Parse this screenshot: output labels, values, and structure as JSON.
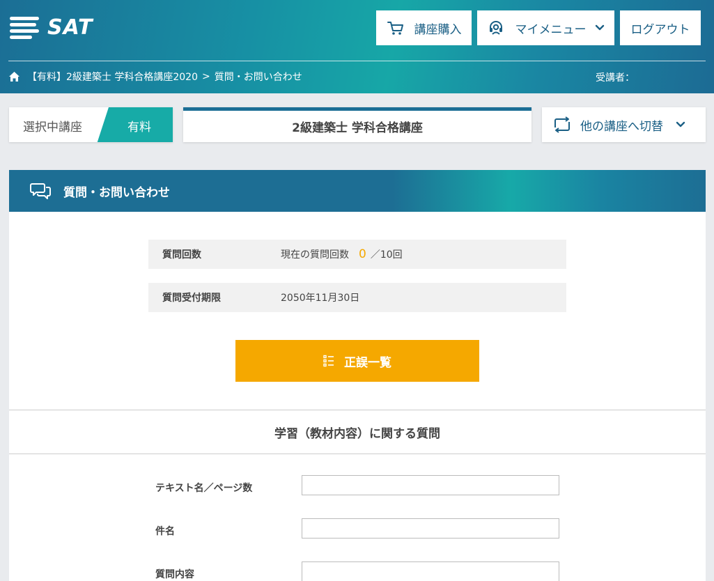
{
  "header": {
    "logo_text": "SAT",
    "cart_label": "講座購入",
    "mymenu_label": "マイメニュー",
    "logout_label": "ログアウト",
    "breadcrumb": {
      "course": "【有料】2級建築士 学科合格講座2020",
      "separator": ">",
      "current": "質問・お問い合わせ"
    },
    "student_label": "受講者："
  },
  "course_bar": {
    "selected_label": "選択中講座",
    "tag": "有料",
    "course_name": "2級建築士 学科合格講座",
    "switch_label": "他の講座へ切替"
  },
  "panel": {
    "title": "質問・お問い合わせ",
    "question_count": {
      "label": "質問回数",
      "prefix": "現在の質問回数",
      "current": "0",
      "suffix": "／10回"
    },
    "deadline": {
      "label": "質問受付期限",
      "value": "2050年11月30日"
    },
    "errata_button": "正誤一覧",
    "section_title": "学習（教材内容）に関する質問",
    "form": {
      "text_page_label": "テキスト名／ページ数",
      "subject_label": "件名",
      "content_label": "質問内容"
    }
  },
  "colors": {
    "header_teal": "#17a7a7",
    "header_blue": "#1b6e95",
    "accent_orange": "#f5a800",
    "tag_teal": "#17aba7"
  }
}
